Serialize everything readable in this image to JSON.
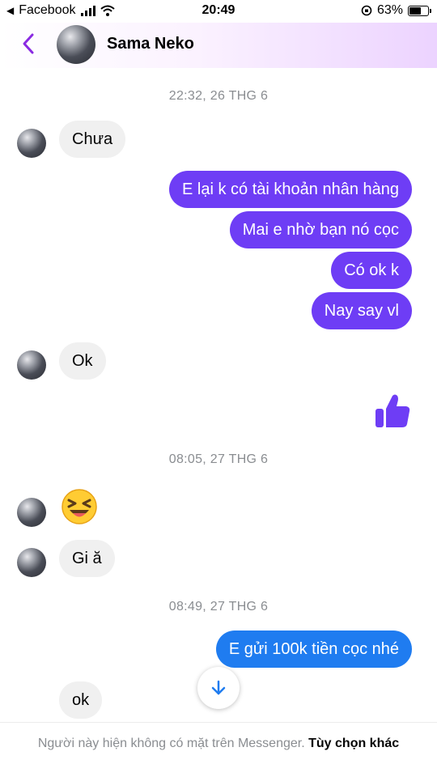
{
  "status_bar": {
    "back_app": "Facebook",
    "time": "20:49",
    "battery": "63%",
    "battery_level": 0.63
  },
  "header": {
    "contact_name": "Sama Neko",
    "back_icon": "chevron-left-icon"
  },
  "colors": {
    "accent": "#8a2be2",
    "outgoing_purple": "#6e3df5",
    "outgoing_blue": "#1f7cf0",
    "incoming_bg": "#f0f0f0",
    "timestamp": "#8a8d91"
  },
  "timestamps": [
    "22:32, 26 THG 6",
    "08:05, 27 THG 6",
    "08:49, 27 THG 6"
  ],
  "messages": [
    {
      "side": "incoming",
      "text": "Chưa"
    },
    {
      "side": "outgoing",
      "text": "E lại k có tài khoản nhân hàng"
    },
    {
      "side": "outgoing",
      "text": "Mai e nhờ bạn nó cọc"
    },
    {
      "side": "outgoing",
      "text": "Có ok k"
    },
    {
      "side": "outgoing",
      "text": "Nay say vl"
    },
    {
      "side": "incoming",
      "text": "Ok"
    },
    {
      "side": "outgoing",
      "icon": "thumbs-up-icon"
    },
    {
      "side": "incoming",
      "icon": "laughing-emoji-icon"
    },
    {
      "side": "incoming",
      "text": "Gi ă"
    },
    {
      "side": "outgoing",
      "text": "E gửi 100k tiền cọc nhé"
    },
    {
      "side": "incoming",
      "text": "ok"
    }
  ],
  "scroll_button_icon": "arrow-down-icon",
  "footer": {
    "text": "Người này hiện không có mặt trên Messenger.",
    "link": "Tùy chọn khác"
  }
}
